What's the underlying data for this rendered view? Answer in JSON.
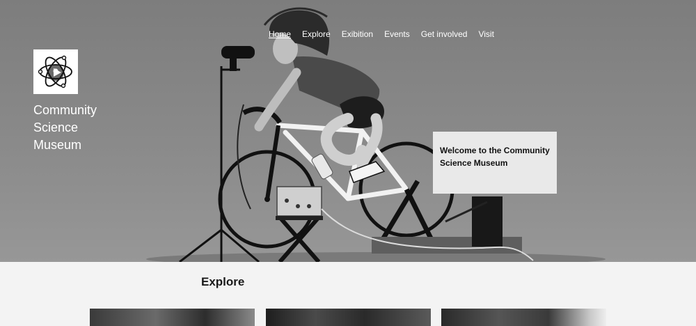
{
  "nav": {
    "items": [
      "Home",
      "Explore",
      "Exibition",
      "Events",
      "Get involved",
      "Visit"
    ],
    "active": "Home"
  },
  "site": {
    "name_lines": [
      "Community",
      "Science",
      "Museum"
    ],
    "logo_icon": "atom-logo-icon"
  },
  "hero": {
    "welcome_text": "Welcome to the Community Science Museum"
  },
  "explore": {
    "title": "Explore",
    "cards": [
      "explore-card-1",
      "explore-card-2",
      "explore-card-3"
    ]
  },
  "colors": {
    "hero_bg": "#868686",
    "card_bg": "#e9e9e9",
    "page_bg": "#f3f3f3"
  }
}
